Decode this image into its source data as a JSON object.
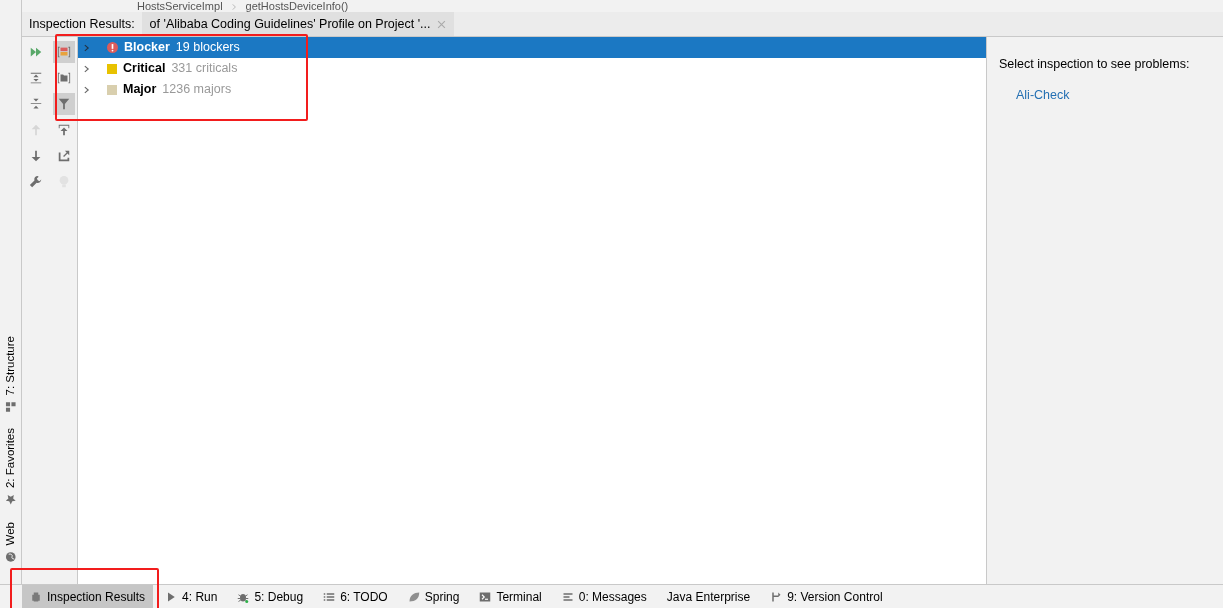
{
  "breadcrumb": [
    "HostsServiceImpl",
    "getHostsDeviceInfo()"
  ],
  "header": {
    "label": "Inspection Results:",
    "tab": {
      "title": "of 'Alibaba Coding Guidelines' Profile on Project '...",
      "selected": true
    }
  },
  "side_stripe": [
    {
      "label": "7: Structure",
      "kind": "structure"
    },
    {
      "label": "2: Favorites",
      "kind": "star"
    },
    {
      "label": "Web",
      "kind": "globe"
    }
  ],
  "toolbar": [
    {
      "kind": "run",
      "selected": false,
      "disabled": false
    },
    {
      "kind": "group-severity",
      "selected": true,
      "disabled": false
    },
    {
      "kind": "expand",
      "selected": false,
      "disabled": false
    },
    {
      "kind": "group-folder",
      "selected": false,
      "disabled": false
    },
    {
      "kind": "collapse",
      "selected": false,
      "disabled": false
    },
    {
      "kind": "filter",
      "selected": true,
      "disabled": false
    },
    {
      "kind": "up",
      "selected": false,
      "disabled": true
    },
    {
      "kind": "autoscroll",
      "selected": false,
      "disabled": false
    },
    {
      "kind": "down",
      "selected": false,
      "disabled": false
    },
    {
      "kind": "export",
      "selected": false,
      "disabled": false
    },
    {
      "kind": "wrench",
      "selected": false,
      "disabled": false
    },
    {
      "kind": "bulb",
      "selected": false,
      "disabled": true
    }
  ],
  "tree": {
    "highlight": true,
    "items": [
      {
        "label": "Blocker",
        "count": "19 blockers",
        "kind": "circle",
        "color": "#db5c5c",
        "selected": true,
        "expanded": false
      },
      {
        "label": "Critical",
        "count": "331 criticals",
        "kind": "square",
        "color": "#e8c200",
        "selected": false,
        "expanded": false
      },
      {
        "label": "Major",
        "count": "1236 majors",
        "kind": "square",
        "color": "#d9cfae",
        "selected": false,
        "expanded": false
      }
    ]
  },
  "details": {
    "message": "Select inspection to see problems:",
    "link": "Ali-Check"
  },
  "bottom_bar": [
    {
      "label": "Inspection Results",
      "kind": "inspect",
      "selected": true,
      "highlight": true
    },
    {
      "label": "4: Run",
      "kind": "run",
      "selected": false,
      "highlight": false
    },
    {
      "label": "5: Debug",
      "kind": "debug",
      "selected": false,
      "highlight": false
    },
    {
      "label": "6: TODO",
      "kind": "todo",
      "selected": false,
      "highlight": false
    },
    {
      "label": "Spring",
      "kind": "spring",
      "selected": false,
      "highlight": false
    },
    {
      "label": "Terminal",
      "kind": "terminal",
      "selected": false,
      "highlight": false
    },
    {
      "label": "0: Messages",
      "kind": "messages",
      "selected": false,
      "highlight": false
    },
    {
      "label": "Java Enterprise",
      "kind": "none",
      "selected": false,
      "highlight": false
    },
    {
      "label": "9: Version Control",
      "kind": "vcs",
      "selected": false,
      "highlight": false
    }
  ]
}
